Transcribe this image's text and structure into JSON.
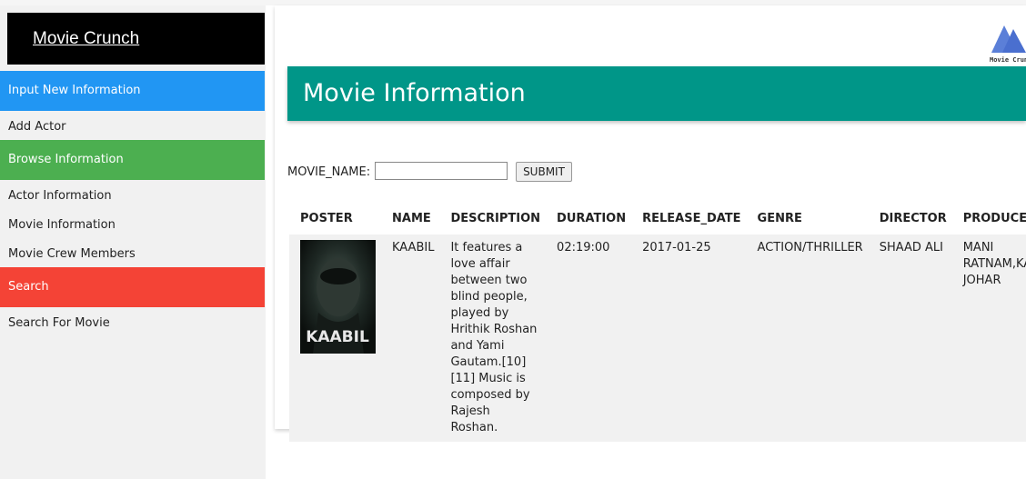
{
  "sidebar": {
    "brand": "Movie Crunch",
    "sections": [
      {
        "label": "Input New Information",
        "color": "#2196F3"
      },
      {
        "label": "Browse Information",
        "color": "#4CAF50"
      },
      {
        "label": "Search",
        "color": "#F44336"
      }
    ],
    "links": {
      "add_actor": "Add Actor",
      "actor_info": "Actor Information",
      "movie_info": "Movie Information",
      "movie_crew": "Movie Crew Members",
      "search_movie": "Search For Movie"
    }
  },
  "main": {
    "logo_text": "Movie Crunch",
    "title": "Movie Information",
    "title_bar_color": "#009688",
    "form": {
      "label": "MOVIE_NAME:",
      "value": "",
      "submit": "SUBMIT"
    },
    "table": {
      "headers": [
        "POSTER",
        "NAME",
        "DESCRIPTION",
        "DURATION",
        "RELEASE_DATE",
        "GENRE",
        "DIRECTOR",
        "PRODUCER"
      ],
      "rows": [
        {
          "poster_title": "KAABIL",
          "name": "KAABIL",
          "description": "It features a love affair between two blind people, played by Hrithik Roshan and Yami Gautam.[10][11] Music is composed by Rajesh Roshan.",
          "duration": "02:19:00",
          "release_date": "2017-01-25",
          "genre": "ACTION/THRILLER",
          "director": "SHAAD ALI",
          "producer": "MANI RATNAM,KARAN JOHAR"
        }
      ]
    }
  }
}
